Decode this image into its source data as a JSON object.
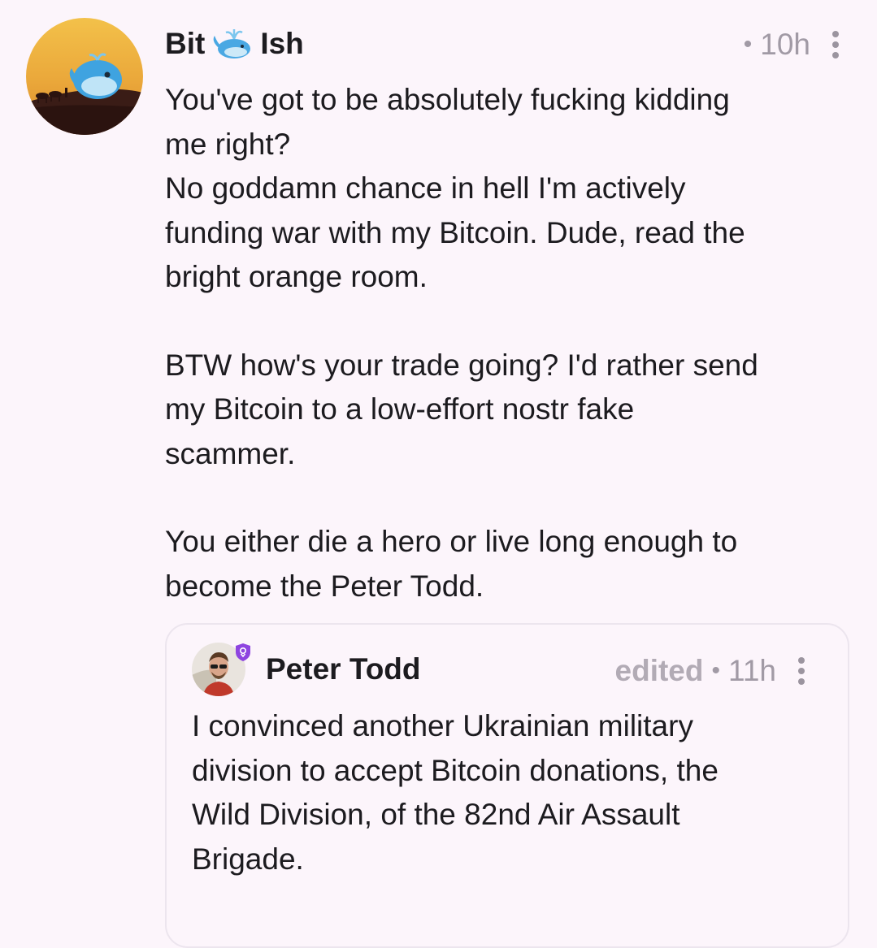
{
  "post": {
    "author": {
      "name_part1": "Bit",
      "name_emoji": "whale-emoji",
      "name_part2": "Ish",
      "avatar": "whale-sunset-avatar"
    },
    "meta": {
      "dot": "•",
      "time": "10h",
      "menu_icon": "more-vertical-icon"
    },
    "paragraphs": [
      "You've got to be absolutely fucking kidding\nme right?\nNo goddamn chance in hell I'm actively\nfunding war with my Bitcoin. Dude, read the\nbright orange room.",
      "BTW how's your trade going? I'd rather send\nmy Bitcoin to a low-effort nostr fake\nscammer.",
      "You either die a hero or live long enough to\nbecome the Peter Todd."
    ]
  },
  "quoted_post": {
    "author": {
      "name": "Peter Todd",
      "avatar": "peter-todd-avatar",
      "badge": "verified-badge-icon"
    },
    "meta": {
      "edited": "edited",
      "dot": "•",
      "time": "11h",
      "menu_icon": "more-vertical-icon"
    },
    "content": "I convinced another Ukrainian military\ndivision to accept Bitcoin donations, the\nWild Division, of the 82nd Air Assault\nBrigade."
  },
  "colors": {
    "background": "#fcf5fb",
    "text": "#1c1b1f",
    "meta": "#a19aa5",
    "badge": "#8e44e0",
    "quote_border": "#ece5ee"
  }
}
